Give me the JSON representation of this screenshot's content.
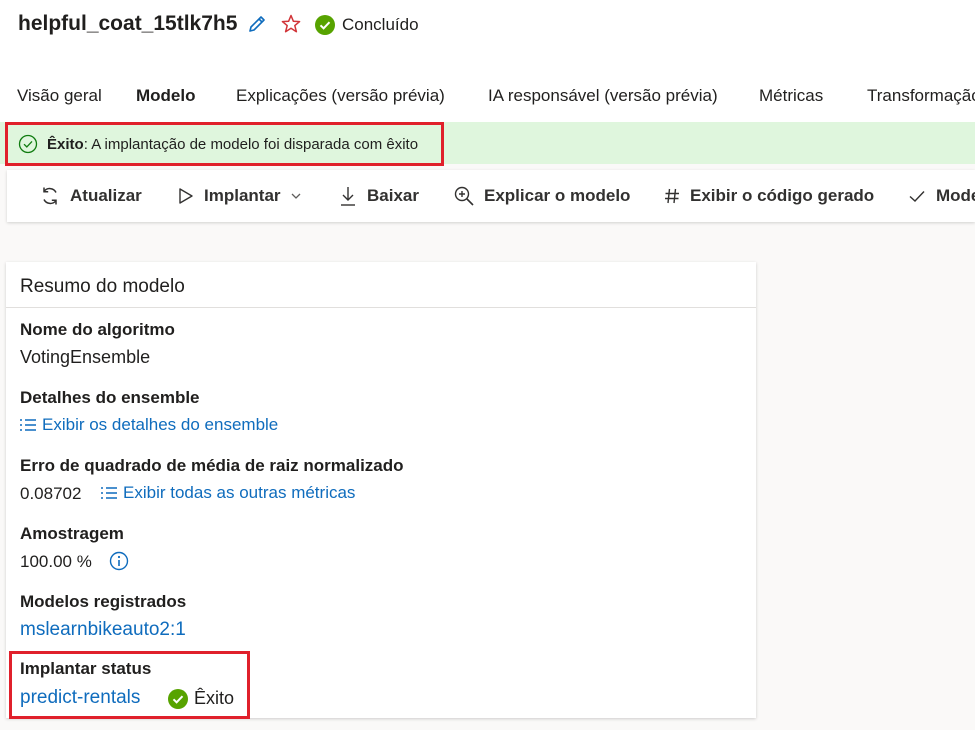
{
  "header": {
    "title": "helpful_coat_15tlk7h5",
    "status": "Concluído"
  },
  "tabs": [
    {
      "label": "Visão geral",
      "active": false
    },
    {
      "label": "Modelo",
      "active": true
    },
    {
      "label": "Explicações (versão prévia)",
      "active": false
    },
    {
      "label": "IA responsável (versão prévia)",
      "active": false
    },
    {
      "label": "Métricas",
      "active": false
    },
    {
      "label": "Transformação",
      "active": false
    }
  ],
  "banner": {
    "bold": "Êxito",
    "message": ": A implantação de modelo foi disparada com êxito"
  },
  "toolbar": {
    "refresh": "Atualizar",
    "deploy": "Implantar",
    "download": "Baixar",
    "explain": "Explicar o modelo",
    "code": "Exibir o código gerado",
    "model": "Mode"
  },
  "summary": {
    "title": "Resumo do modelo",
    "algorithm_label": "Nome do algoritmo",
    "algorithm_value": "VotingEnsemble",
    "ensemble_label": "Detalhes do ensemble",
    "ensemble_link": "Exibir os detalhes do ensemble",
    "metric_label": "Erro de quadrado de média de raiz normalizado",
    "metric_value": "0.08702",
    "metric_link": "Exibir todas as outras métricas",
    "sampling_label": "Amostragem",
    "sampling_value": "100.00 %",
    "registered_label": "Modelos registrados",
    "registered_link": "mslearnbikeauto2:1",
    "deploy_label": "Implantar status",
    "deploy_link": "predict-rentals",
    "deploy_status": "Êxito"
  },
  "colors": {
    "accent_link": "#0f6cbd",
    "success_green": "#57a300",
    "banner_bg": "#dff6dd",
    "highlight_red": "#e0202b"
  }
}
